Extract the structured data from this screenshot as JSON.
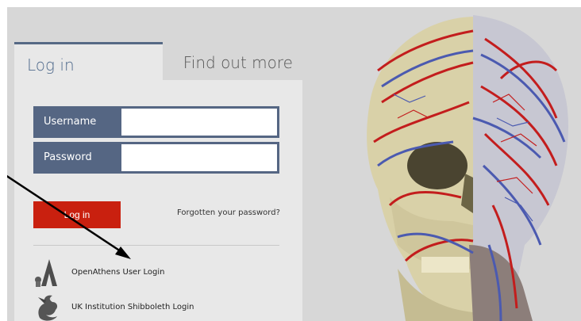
{
  "tabs": {
    "login": "Log in",
    "find_out_more": "Find out more"
  },
  "form": {
    "username_label": "Username",
    "username_value": "",
    "password_label": "Password",
    "password_value": "",
    "login_button": "Log in",
    "forgot_link": "Forgotten your password?"
  },
  "alt_logins": {
    "openathens": "OpenAthens User Login",
    "shibboleth": "UK Institution Shibboleth Login"
  },
  "colors": {
    "accent_blue": "#556683",
    "login_red": "#c9200f",
    "panel_bg": "#e8e8e8",
    "page_bg": "#d7d7d7"
  },
  "icons": [
    "openathens-logo-icon",
    "shibboleth-dragon-icon",
    "anatomy-head-illustration",
    "annotation-arrow"
  ]
}
